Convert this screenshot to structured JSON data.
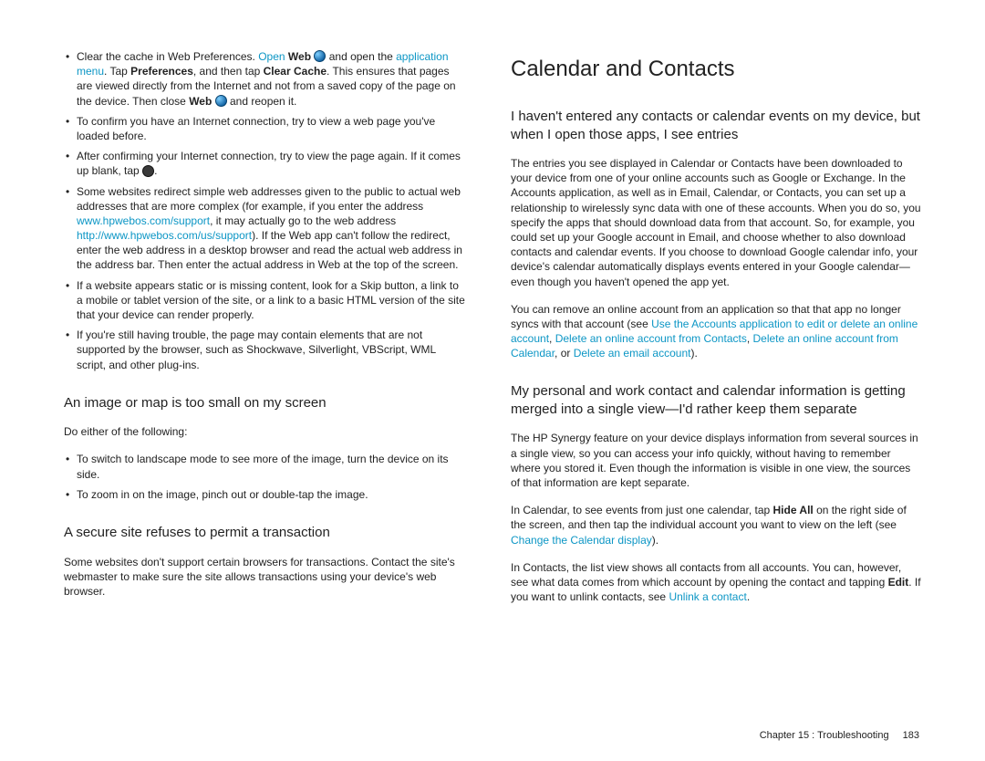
{
  "left": {
    "bullets": [
      {
        "pre": "Clear the cache in Web Preferences. ",
        "open": "Open",
        "web1": "Web",
        "mid1": " and open the ",
        "appmenu": "application menu",
        "mid2": ". Tap ",
        "prefs": "Preferences",
        "mid3": ", and then tap ",
        "clearcache": "Clear Cache",
        "mid4": ". This ensures that pages are viewed directly from the Internet and not from a saved copy of the page on the device. Then close ",
        "web2": "Web",
        "mid5": " and reopen it."
      },
      {
        "text": "To confirm you have an Internet connection, try to view a web page you've loaded before."
      },
      {
        "pre": "After confirming your Internet connection, try to view the page again. If it comes up blank, tap ",
        "post": "."
      },
      {
        "pre": "Some websites redirect simple web addresses given to the public to actual web addresses that are more complex (for example, if you enter the address ",
        "link1": "www.hpwebos.com/support",
        "mid": ", it may actually go to the web address ",
        "link2": "http://www.hpwebos.com/us/support",
        "post": "). If the Web app can't follow the redirect, enter the web address in a desktop browser and read the actual web address in the address bar. Then enter the actual address in Web at the top of the screen."
      },
      {
        "text": "If a website appears static or is missing content, look for a Skip button, a link to a mobile or tablet version of the site, or a link to a basic HTML version of the site that your device can render properly."
      },
      {
        "text": "If you're still having trouble, the page may contain elements that are not supported by the browser, such as Shockwave, Silverlight, VBScript, WML script, and other plug-ins."
      }
    ],
    "h2a": "An image or map is too small on my screen",
    "p1": "Do either of the following:",
    "bullets2": [
      "To switch to landscape mode to see more of the image, turn the device on its side.",
      "To zoom in on the image, pinch out or double-tap the image."
    ],
    "h2b": "A secure site refuses to permit a transaction",
    "p2": "Some websites don't support certain browsers for transactions. Contact the site's webmaster to make sure the site allows transactions using your device's web browser."
  },
  "right": {
    "h1": "Calendar and Contacts",
    "h2a": "I haven't entered any contacts or calendar events on my device, but when I open those apps, I see entries",
    "p1": "The entries you see displayed in Calendar or Contacts have been downloaded to your device from one of your online accounts such as Google or Exchange. In the Accounts application, as well as in Email, Calendar, or Contacts, you can set up a relationship to wirelessly sync data with one of these accounts. When you do so, you specify the apps that should download data from that account. So, for example, you could set up your Google account in Email, and choose whether to also download contacts and calendar events. If you choose to download Google calendar info, your device's calendar automatically displays events entered in your Google calendar—even though you haven't opened the app yet.",
    "p2_pre": "You can remove an online account from an application so that that app no longer syncs with that account (see ",
    "p2_link1": "Use the Accounts application to edit or delete an online account",
    "p2_mid1": ", ",
    "p2_link2": "Delete an online account from Contacts",
    "p2_mid2": ", ",
    "p2_link3": "Delete an online account from Calendar",
    "p2_mid3": ", or ",
    "p2_link4": "Delete an email account",
    "p2_post": ").",
    "h2b": "My personal and work contact and calendar information is getting merged into a single view—I'd rather keep them separate",
    "p3": "The HP Synergy feature on your device displays information from several sources in a single view, so you can access your info quickly, without having to remember where you stored it. Even though the information is visible in one view, the sources of that information are kept separate.",
    "p4_pre": "In Calendar, to see events from just one calendar, tap ",
    "p4_bold": "Hide All",
    "p4_mid": " on the right side of the screen, and then tap the individual account you want to view on the left (see ",
    "p4_link": "Change the Calendar display",
    "p4_post": ").",
    "p5_pre": "In Contacts, the list view shows all contacts from all accounts. You can, however, see what data comes from which account by opening the contact and tapping ",
    "p5_bold": "Edit",
    "p5_mid": ". If you want to unlink contacts, see ",
    "p5_link": "Unlink a contact",
    "p5_post": "."
  },
  "footer": {
    "chapter": "Chapter 15 : Troubleshooting",
    "page": "183"
  }
}
